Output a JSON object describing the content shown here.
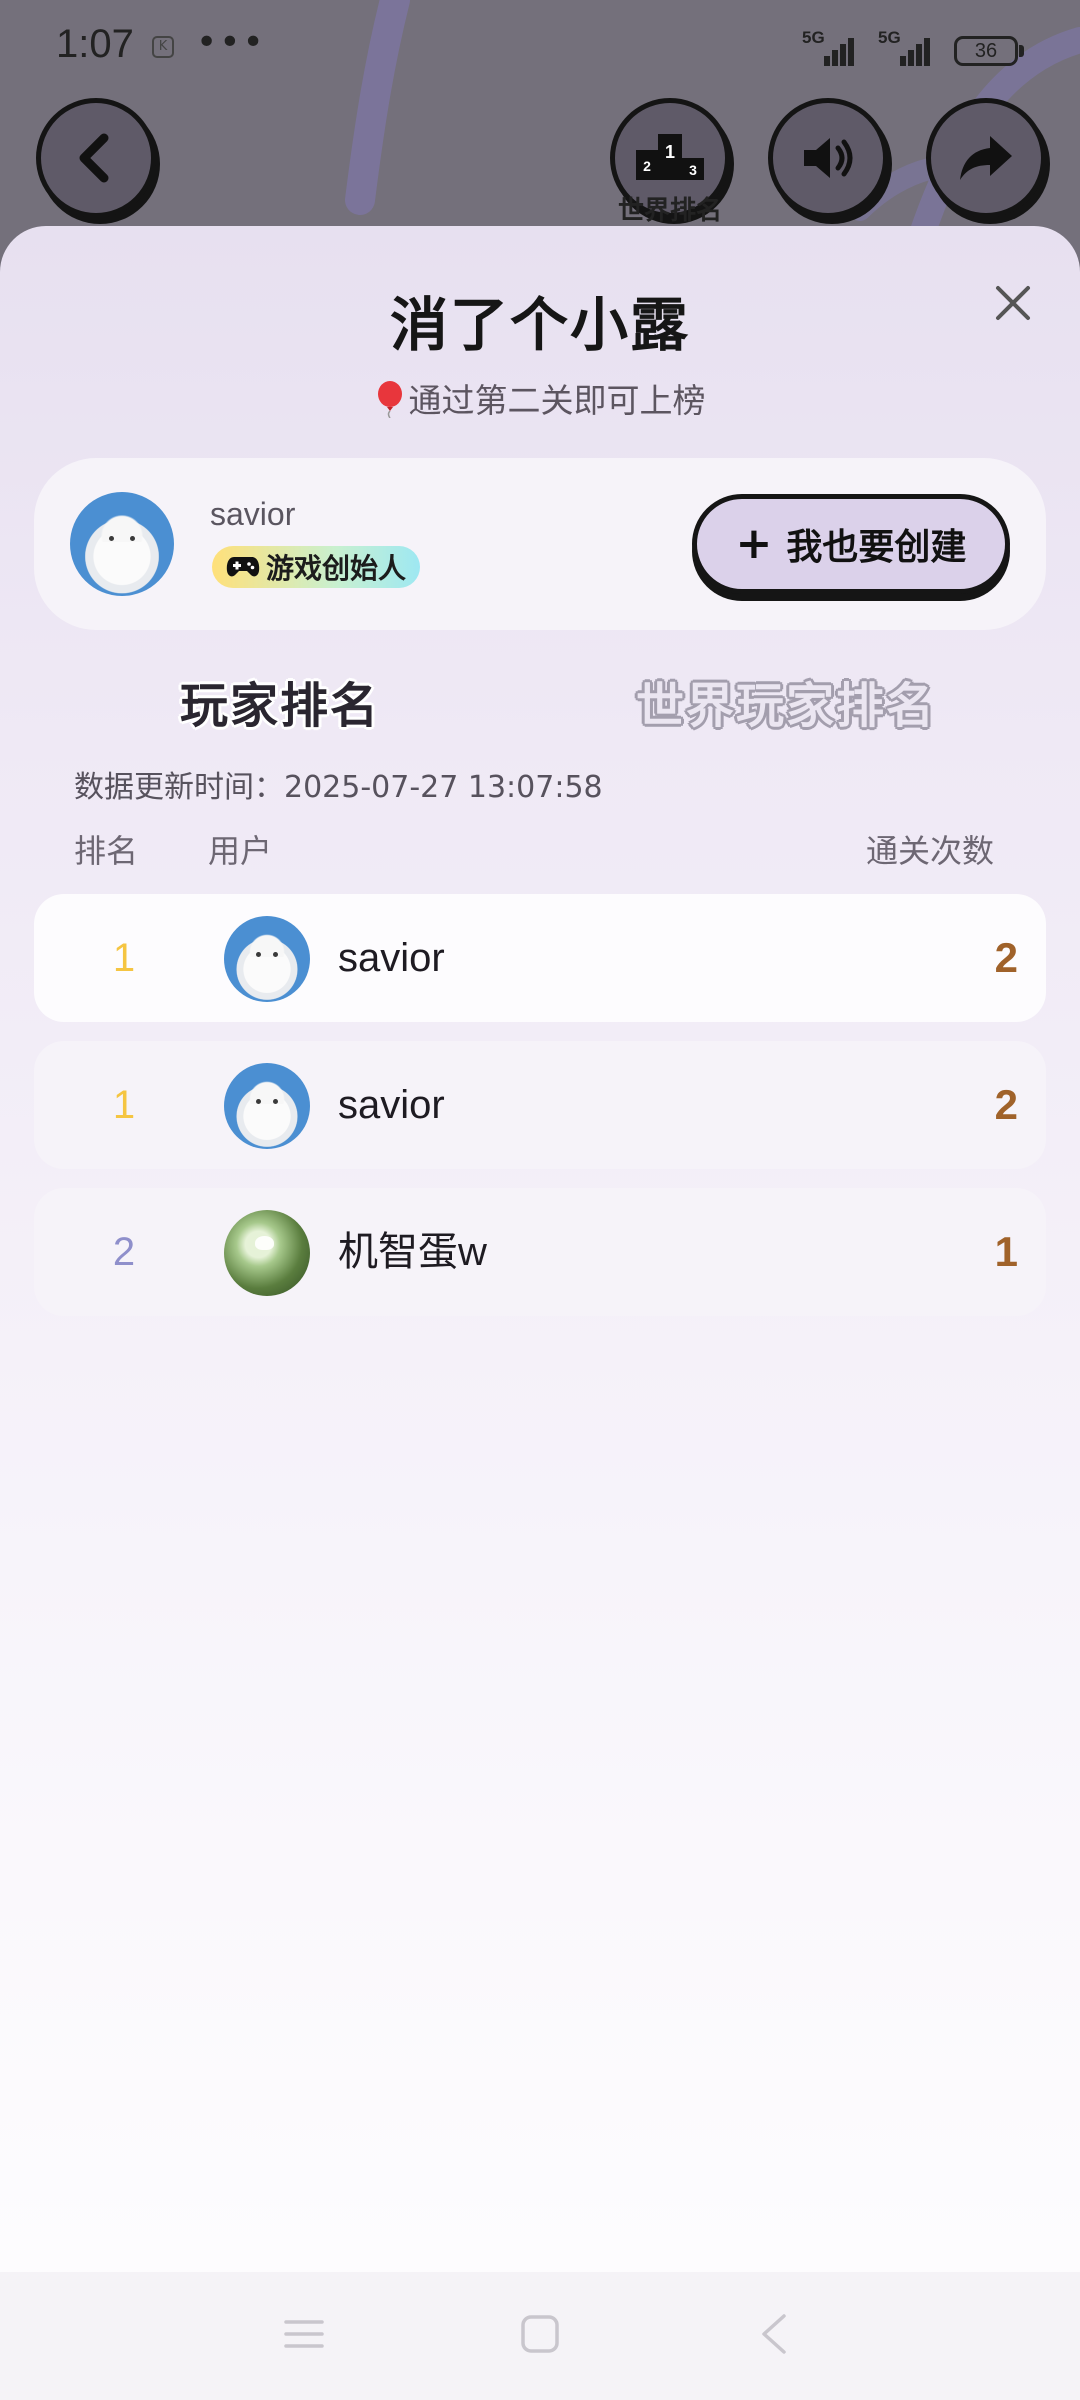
{
  "status_bar": {
    "time": "1:07",
    "mini_icon": "K",
    "dots": "•••",
    "signal_1": "5G",
    "signal_2": "5G",
    "battery": "36"
  },
  "game_header": {
    "leaderboard_label": "世界排名",
    "icons": [
      "back-icon",
      "podium-icon",
      "speaker-icon",
      "share-icon"
    ]
  },
  "sheet": {
    "title": "消了个小露",
    "hint": "通过第二关即可上榜"
  },
  "profile": {
    "name": "savior",
    "badge": "游戏创始人",
    "create_button": "我也要创建",
    "create_icon": "+"
  },
  "tabs": [
    {
      "label": "玩家排名",
      "active": true
    },
    {
      "label": "世界玩家排名",
      "active": false
    }
  ],
  "update_time": "数据更新时间：2025-07-27 13:07:58",
  "columns": {
    "rank": "排名",
    "user": "用户",
    "clears": "通关次数"
  },
  "rows": [
    {
      "rank": "1",
      "name": "savior",
      "clears": "2",
      "rank_color": "#f5c542",
      "avatar": "cat"
    },
    {
      "rank": "1",
      "name": "savior",
      "clears": "2",
      "rank_color": "#f5c542",
      "avatar": "cat"
    },
    {
      "rank": "2",
      "name": "机智蛋w",
      "clears": "1",
      "rank_color": "#8f8fcb",
      "avatar": "nature"
    }
  ],
  "colors": {
    "accent": "#dbd1ea",
    "count": "#a0622a"
  }
}
